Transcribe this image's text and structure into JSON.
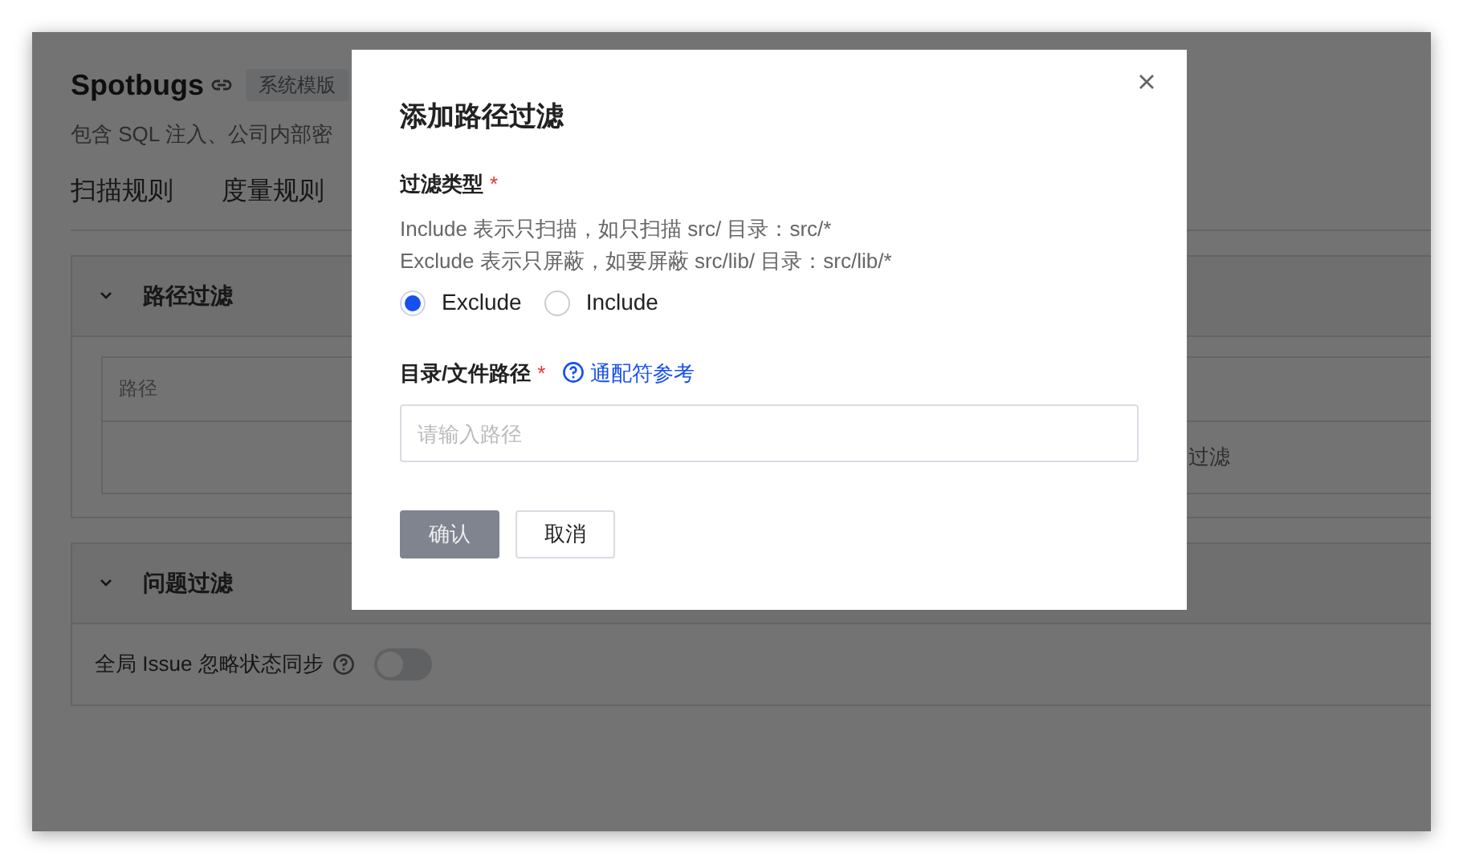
{
  "page": {
    "title": "Spotbugs",
    "tag": "系统模版",
    "description": "包含 SQL 注入、公司内部密",
    "tabs": [
      {
        "label": "扫描规则"
      },
      {
        "label": "度量规则"
      }
    ],
    "sections": [
      {
        "kind": "table",
        "title": "路径过滤",
        "columns": [
          "路径"
        ],
        "empty_text": "过滤"
      },
      {
        "kind": "switch",
        "title": "问题过滤",
        "label": "全局 Issue 忽略状态同步",
        "on": false
      }
    ]
  },
  "dialog": {
    "title": "添加路径过滤",
    "type_field": {
      "label": "过滤类型",
      "required_mark": "*",
      "hints": [
        "Include 表示只扫描，如只扫描 src/ 目录：src/*",
        "Exclude 表示只屏蔽，如要屏蔽 src/lib/ 目录：src/lib/*"
      ],
      "options": [
        {
          "label": "Exclude",
          "selected": true
        },
        {
          "label": "Include",
          "selected": false
        }
      ]
    },
    "path_field": {
      "label": "目录/文件路径",
      "required_mark": "*",
      "help_link": "通配符参考",
      "placeholder": "请输入路径"
    },
    "buttons": [
      {
        "kind": "primary",
        "label": "确认",
        "disabled": true
      },
      {
        "kind": "default",
        "label": "取消",
        "disabled": false
      }
    ]
  }
}
